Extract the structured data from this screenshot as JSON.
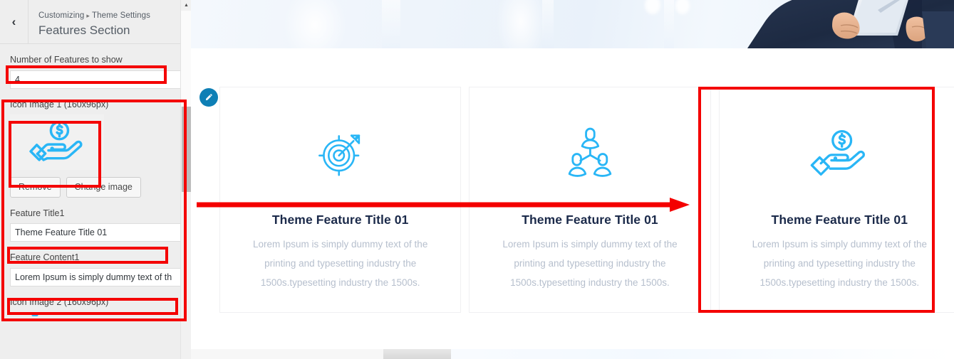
{
  "sidebar": {
    "back_icon": "chevron-left-icon",
    "breadcrumb_root": "Customizing",
    "breadcrumb_separator": "▸",
    "breadcrumb_parent": "Theme Settings",
    "panel_title": "Features Section",
    "controls": {
      "number_label": "Number of Features to show",
      "number_value": "4",
      "icon1_label": "Icon Image 1 (160x96px)",
      "icon1_image": "hand-holding-dollar-icon",
      "remove_label": "Remove",
      "change_image_label": "Change image",
      "title1_label": "Feature Title1",
      "title1_value": "Theme Feature Title 01",
      "content1_label": "Feature Content1",
      "content1_value": "Lorem Ipsum is simply dummy text of th",
      "icon2_label": "Icon Image 2 (160x96px)"
    },
    "scrollbar": {
      "up_arrow": "▲"
    }
  },
  "preview": {
    "hero_alt": "businessman-holding-tablet-banner",
    "edit_shortcut_icon": "pencil-edit-icon",
    "cards": [
      {
        "icon": "target-arrow-icon",
        "title": "Theme Feature Title 01",
        "text": "Lorem Ipsum is simply dummy text of the printing and typesetting industry the 1500s.typesetting industry the 1500s."
      },
      {
        "icon": "team-network-icon",
        "title": "Theme Feature Title 01",
        "text": "Lorem Ipsum is simply dummy text of the printing and typesetting industry the 1500s.typesetting industry the 1500s."
      },
      {
        "icon": "hand-holding-dollar-icon",
        "title": "Theme Feature Title 01",
        "text": "Lorem Ipsum is simply dummy text of the printing and typesetting industry the 1500s.typesetting industry the 1500s."
      }
    ]
  },
  "annotations": {
    "color": "#f40000",
    "arrow_label": "red-pointer-arrow"
  },
  "colors": {
    "accent_blue": "#29b6f6",
    "title_navy": "#1b2a4a",
    "body_gray": "#b6bfcd",
    "annotation_red": "#f40000",
    "sidebar_bg": "#eeeeee"
  }
}
